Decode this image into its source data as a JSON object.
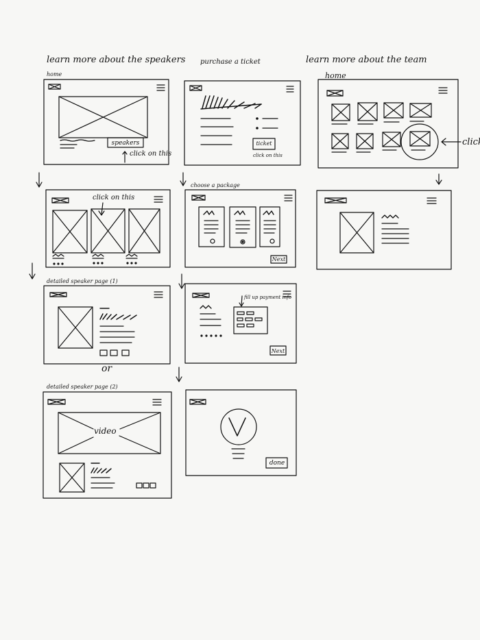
{
  "colors": {
    "ink": "#111111",
    "paper": "#f7f7f5"
  },
  "columns": {
    "speakers": "learn more about the speakers",
    "ticket": "purchase a ticket",
    "team": "learn more about the team"
  },
  "frames": {
    "home_speakers": {
      "caption": "home",
      "button": "speakers",
      "annotation": "click on this"
    },
    "ticket_home": {
      "button": "ticket",
      "annotation": "click on this"
    },
    "team_home": {
      "caption": "home",
      "annotation": "click"
    },
    "speakers_list": {
      "annotation": "click on this"
    },
    "choose_package": {
      "caption": "choose a package",
      "button": "Next"
    },
    "speaker_detail_1": {
      "caption": "detailed speaker page (1)"
    },
    "fill_info": {
      "annotation": "fill up payment info",
      "button": "Next"
    },
    "separator": "or",
    "speaker_detail_2": {
      "caption": "detailed speaker page (2)",
      "video_label": "video"
    },
    "confirmation": {
      "button": "done"
    }
  }
}
